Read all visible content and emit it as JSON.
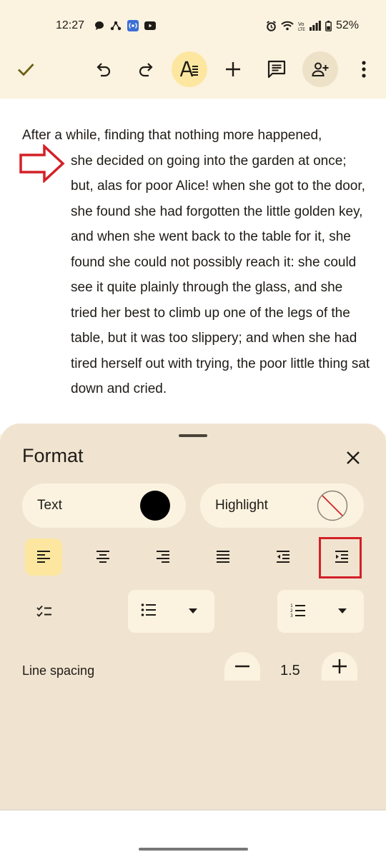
{
  "status_bar": {
    "time": "12:27",
    "battery": "52%",
    "icons": [
      "chat-bubble-icon",
      "network-icon",
      "radio-icon",
      "youtube-icon",
      "alarm-icon",
      "wifi-icon",
      "volte-icon",
      "signal-icon",
      "battery-icon"
    ]
  },
  "toolbar": {
    "done_icon": "check-icon",
    "undo_icon": "undo-icon",
    "redo_icon": "redo-icon",
    "format_icon": "text-format-icon",
    "insert_icon": "plus-icon",
    "comment_icon": "comment-icon",
    "share_icon": "add-person-icon",
    "more_icon": "more-vert-icon",
    "accent": "#fde7a0"
  },
  "document": {
    "first_line": "After a while, finding that nothing more happened,",
    "indented_text": "she decided on going into the garden at once; but, alas for poor Alice! when she got to the door, she found she had forgotten the little golden key, and when she went back to the table for it, she found she could not possibly reach it: she could see it quite plainly through the glass, and she tried her best to climb up one of the legs of the table, but it was too slippery; and when she had tired herself out with trying, the poor little thing sat down and cried.",
    "annotation_color": "#d32027"
  },
  "format_sheet": {
    "title": "Format",
    "text_color_label": "Text",
    "text_color_value": "#000000",
    "highlight_label": "Highlight",
    "alignment_buttons": [
      "align-left-icon",
      "align-center-icon",
      "align-right-icon",
      "align-justify-icon",
      "decrease-indent-icon",
      "increase-indent-icon"
    ],
    "active_alignment": "align-left",
    "line_spacing_label": "Line spacing",
    "line_spacing_value": "1.5"
  }
}
